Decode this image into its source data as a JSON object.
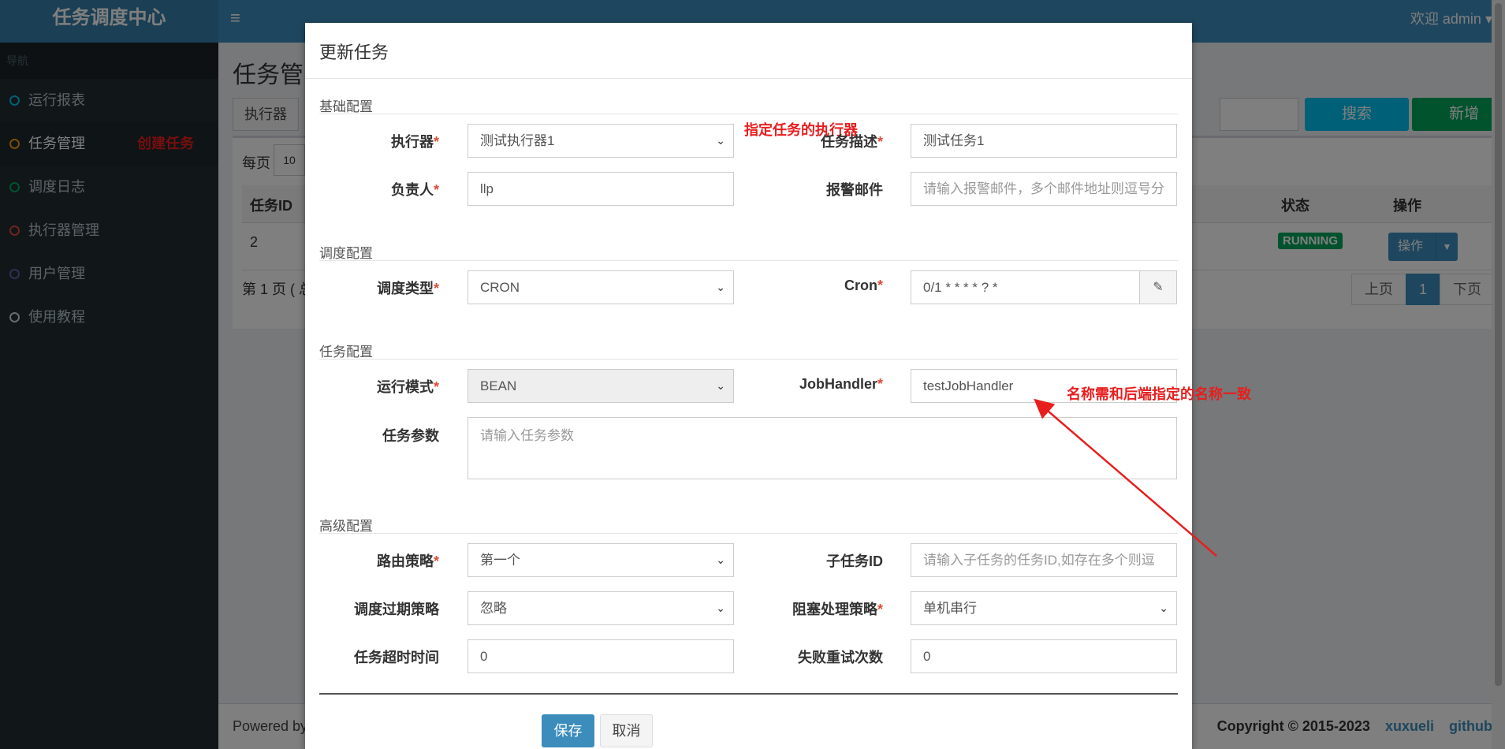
{
  "app": {
    "title": "任务调度中心",
    "welcome": "欢迎 admin",
    "menu_icon": "hamburger-icon"
  },
  "sidebar": {
    "header": "导航",
    "items": [
      {
        "label": "运行报表",
        "color": "#00c0ef"
      },
      {
        "label": "任务管理",
        "color": "#f39c12",
        "active": true
      },
      {
        "label": "调度日志",
        "color": "#00a65a"
      },
      {
        "label": "执行器管理",
        "color": "#dd4b39"
      },
      {
        "label": "用户管理",
        "color": "#605ca8"
      },
      {
        "label": "使用教程",
        "color": "#d2d6de"
      }
    ],
    "annotation": "创建任务"
  },
  "background": {
    "page_title": "任务管",
    "filter": {
      "executor_label": "执行器"
    },
    "search_label": "搜索",
    "add_label": "新增",
    "per_page_label": "每页",
    "per_page_value": "10",
    "table": {
      "headers": {
        "id": "任务ID",
        "status": "状态",
        "ops": "操作"
      },
      "rows": [
        {
          "id": "2",
          "status": "RUNNING",
          "ops_label": "操作"
        }
      ]
    },
    "pager_info": "第 1 页 ( 总",
    "pager": {
      "prev": "上页",
      "current": "1",
      "next": "下页"
    },
    "footer": {
      "left": "Powered by",
      "copyright": "Copyright © 2015-2023",
      "author": "xuxueli",
      "github": "github"
    }
  },
  "modal": {
    "title": "更新任务",
    "sections": {
      "basic": "基础配置",
      "schedule": "调度配置",
      "task": "任务配置",
      "advanced": "高级配置"
    },
    "annotations": {
      "executor_hint": "指定任务的执行器",
      "handler_hint": "名称需和后端指定的名称一致"
    },
    "fields": {
      "executor": {
        "label": "执行器",
        "value": "测试执行器1"
      },
      "desc": {
        "label": "任务描述",
        "value": "测试任务1"
      },
      "owner": {
        "label": "负责人",
        "value": "llp"
      },
      "alarm": {
        "label": "报警邮件",
        "placeholder": "请输入报警邮件，多个邮件地址则逗号分"
      },
      "schedule_type": {
        "label": "调度类型",
        "value": "CRON"
      },
      "cron": {
        "label": "Cron",
        "value": "0/1 * * * * ? *"
      },
      "run_mode": {
        "label": "运行模式",
        "value": "BEAN"
      },
      "job_handler": {
        "label": "JobHandler",
        "value": "testJobHandler"
      },
      "params": {
        "label": "任务参数",
        "placeholder": "请输入任务参数"
      },
      "route": {
        "label": "路由策略",
        "value": "第一个"
      },
      "child_id": {
        "label": "子任务ID",
        "placeholder": "请输入子任务的任务ID,如存在多个则逗"
      },
      "misfire": {
        "label": "调度过期策略",
        "value": "忽略"
      },
      "block": {
        "label": "阻塞处理策略",
        "value": "单机串行"
      },
      "timeout": {
        "label": "任务超时时间",
        "value": "0"
      },
      "retry": {
        "label": "失败重试次数",
        "value": "0"
      }
    },
    "buttons": {
      "save": "保存",
      "cancel": "取消"
    }
  }
}
